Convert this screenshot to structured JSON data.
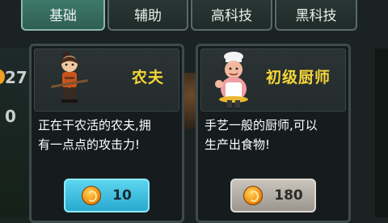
{
  "tabs": [
    {
      "label": "基础",
      "active": true
    },
    {
      "label": "辅助",
      "active": false
    },
    {
      "label": "高科技",
      "active": false
    },
    {
      "label": "黑科技",
      "active": false
    }
  ],
  "background": {
    "stat_1": "27",
    "stat_2": "0"
  },
  "cards": [
    {
      "name": "农夫",
      "desc_line1": "正在干农活的农夫,拥",
      "desc_line2": "有一点点的攻击力!",
      "price": "10",
      "button_style": "blue"
    },
    {
      "name": "初级厨师",
      "desc_line1": "手艺一般的厨师,可以",
      "desc_line2": "生产出食物!",
      "price": "180",
      "button_style": "gray"
    }
  ],
  "colors": {
    "title": "#f6d638",
    "tab_active": "#3f7a6b",
    "price_blue": "#2aa9cf",
    "price_gray": "#9c978e"
  },
  "icons": [
    "farmer-icon",
    "chef-icon",
    "coin-icon"
  ]
}
